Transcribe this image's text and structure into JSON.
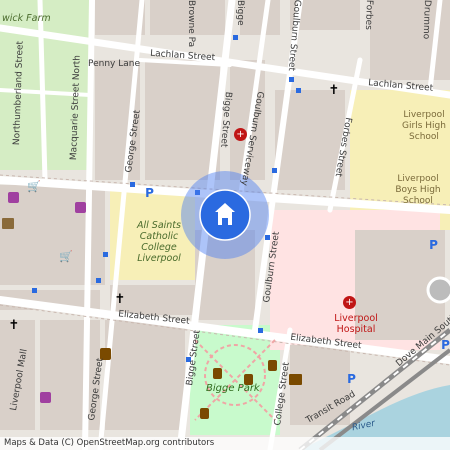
{
  "map": {
    "attribution": "Maps & Data (C) OpenStreetMap.org contributors",
    "colors": {
      "background": "#e9e5df",
      "block": "#d9d0c9",
      "school_area": "#f7efb7",
      "park": "#c8facc",
      "hospital_area": "#ffe3e3",
      "water": "#aad3df",
      "road": "#ffffff",
      "accent_blue": "#2a6ae0"
    },
    "streets": [
      "Lachlan Street",
      "Lachlan Street",
      "Penny Lane",
      "Browne Pa",
      "Bigge",
      "Bigge Street",
      "Goulburn Serviceway",
      "Goulburn Street",
      "Forbes Street",
      "Forbes",
      "Drummo",
      "Northumberland Street",
      "Macquarie Street North",
      "George Street",
      "Goulburn Street",
      "Elizabeth Street",
      "Elizabeth Street",
      "George Street",
      "Bigge Street",
      "College Street",
      "Liverpool Mall",
      "Transit Road",
      "Dove Main South",
      "wick Farm",
      "River"
    ],
    "places": {
      "school_1": "All Saints Catholic College Liverpool",
      "school_2": "Liverpool Girls High School",
      "school_3": "Liverpool Boys High School",
      "hospital": "Liverpool Hospital",
      "park": "Bigge Park"
    },
    "icons": [
      "location-home-marker",
      "hospital-icon",
      "hospital-icon",
      "church-icon",
      "church-icon",
      "church-icon",
      "shopping-cart-icon",
      "shopping-cart-icon",
      "shopping-bag-icon",
      "shopping-bag-icon",
      "shopping-bag-icon",
      "cinema-icon",
      "parking-icon",
      "parking-icon",
      "parking-icon",
      "parking-icon",
      "memorial-icon",
      "library-icon",
      "info-icon"
    ]
  }
}
